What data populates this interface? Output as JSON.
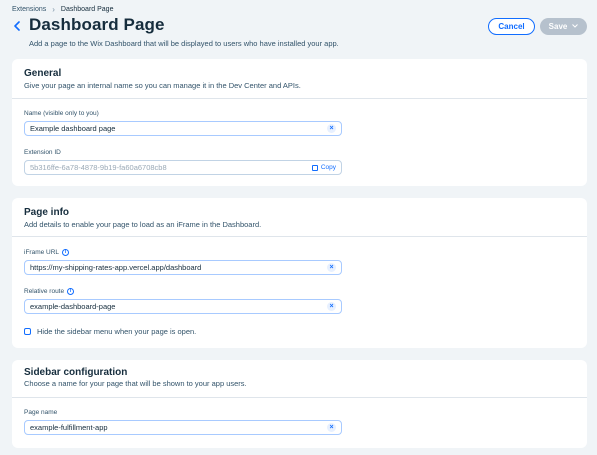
{
  "breadcrumb": {
    "items": [
      "Extensions",
      "Dashboard Page"
    ],
    "separator": "›"
  },
  "header": {
    "title": "Dashboard Page",
    "subtitle": "Add a page to the Wix Dashboard that will be displayed to users who have installed your app.",
    "cancel_label": "Cancel",
    "save_label": "Save"
  },
  "general": {
    "title": "General",
    "description": "Give your page an internal name so you can manage it in the Dev Center and APIs.",
    "name_label": "Name (visible only to you)",
    "name_value": "Example dashboard page",
    "extension_id_label": "Extension ID",
    "extension_id_value": "5b316ffe-6a78-4878-9b19-fa60a6708cb8",
    "copy_label": "Copy"
  },
  "page_info": {
    "title": "Page info",
    "description": "Add details to enable your page to load as an iFrame in the Dashboard.",
    "iframe_label": "iFrame URL",
    "iframe_value": "https://my-shipping-rates-app.vercel.app/dashboard",
    "route_label": "Relative route",
    "route_value": "example-dashboard-page",
    "hide_sidebar_label": "Hide the sidebar menu when your page is open.",
    "hide_sidebar_checked": false
  },
  "sidebar_config": {
    "title": "Sidebar configuration",
    "description": "Choose a name for your page that will be shown to your app users.",
    "page_name_label": "Page name",
    "page_name_value": "example-fulfillment-app"
  },
  "colors": {
    "accent": "#116dff",
    "background": "#f0f4f7",
    "text": "#162d3d",
    "disabled_button": "#b6c1cd"
  }
}
